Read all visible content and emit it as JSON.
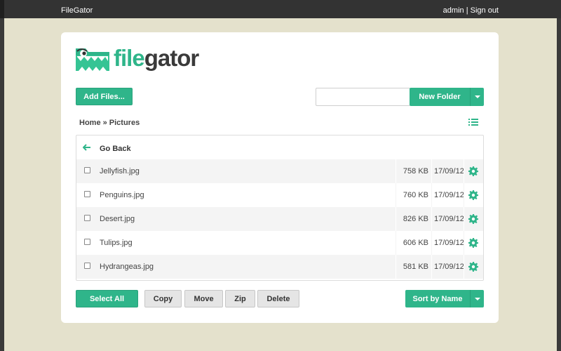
{
  "topbar": {
    "brand": "FileGator",
    "user": "admin",
    "separator": "|",
    "signout": "Sign out"
  },
  "logo": {
    "part1": "file",
    "part2": "gator",
    "icon": "gator-folder-logo"
  },
  "toolbar": {
    "add_files": "Add Files...",
    "search_value": "",
    "new_folder": "New Folder"
  },
  "breadcrumb": "Home » Pictures",
  "file_list": {
    "go_back": "Go Back",
    "files": [
      {
        "name": "Jellyfish.jpg",
        "size": "758 KB",
        "date": "17/09/12"
      },
      {
        "name": "Penguins.jpg",
        "size": "760 KB",
        "date": "17/09/12"
      },
      {
        "name": "Desert.jpg",
        "size": "826 KB",
        "date": "17/09/12"
      },
      {
        "name": "Tulips.jpg",
        "size": "606 KB",
        "date": "17/09/12"
      },
      {
        "name": "Hydrangeas.jpg",
        "size": "581 KB",
        "date": "17/09/12"
      }
    ]
  },
  "actions": {
    "select_all": "Select All",
    "copy": "Copy",
    "move": "Move",
    "zip": "Zip",
    "delete": "Delete",
    "sort_by": "Sort by Name"
  },
  "colors": {
    "accent": "#2fb58a",
    "topbar": "#333333",
    "background": "#e4e1cc"
  }
}
